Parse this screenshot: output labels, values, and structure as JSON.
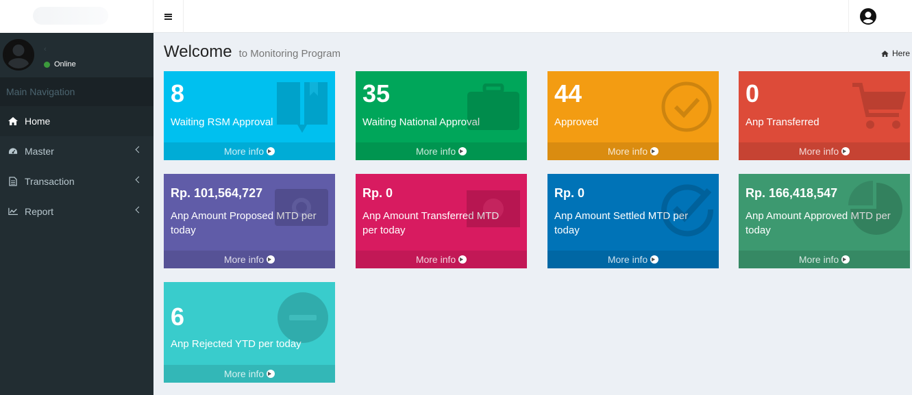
{
  "header": {
    "menu_icon": "bars-icon",
    "user_icon": "user-avatar-icon"
  },
  "sidebar": {
    "user_status": "Online",
    "nav_header": "Main Navigation",
    "items": [
      {
        "label": "Home",
        "icon": "home-icon",
        "active": true
      },
      {
        "label": "Master",
        "icon": "dashboard-icon",
        "active": false
      },
      {
        "label": "Transaction",
        "icon": "file-text-icon",
        "active": false
      },
      {
        "label": "Report",
        "icon": "line-chart-icon",
        "active": false
      }
    ]
  },
  "page": {
    "title": "Welcome",
    "subtitle": "to Monitoring Program",
    "breadcrumb": "Here"
  },
  "boxes": [
    {
      "value": "8",
      "label": "Waiting RSM Approval",
      "footer": "More info",
      "color": "#00c0ef",
      "icon": "book-icon"
    },
    {
      "value": "35",
      "label": "Waiting National Approval",
      "footer": "More info",
      "color": "#00a65a",
      "icon": "briefcase-icon"
    },
    {
      "value": "44",
      "label": "Approved",
      "footer": "More info",
      "color": "#f39c12",
      "icon": "check-circle-icon"
    },
    {
      "value": "0",
      "label": "Anp Transferred",
      "footer": "More info",
      "color": "#dd4b39",
      "icon": "cart-icon"
    },
    {
      "value": "Rp. 101,564,727",
      "label": "Anp Amount Proposed MTD per today",
      "footer": "More info",
      "color": "#605ca8",
      "icon": "camera-icon"
    },
    {
      "value": "Rp. 0",
      "label": "Anp Amount Transferred MTD per today",
      "footer": "More info",
      "color": "#d81b60",
      "icon": "money-icon"
    },
    {
      "value": "Rp. 0",
      "label": "Anp Amount Settled MTD per today",
      "footer": "More info",
      "color": "#0073b7",
      "icon": "check-circle-outline-icon"
    },
    {
      "value": "Rp. 166,418,547",
      "label": "Anp Amount Approved MTD per today",
      "footer": "More info",
      "color": "#3d9970",
      "icon": "pie-chart-icon"
    },
    {
      "value": "6",
      "label": "Anp Rejected YTD per today",
      "footer": "More info",
      "color": "#39cccc",
      "icon": "minus-circle-icon"
    }
  ]
}
